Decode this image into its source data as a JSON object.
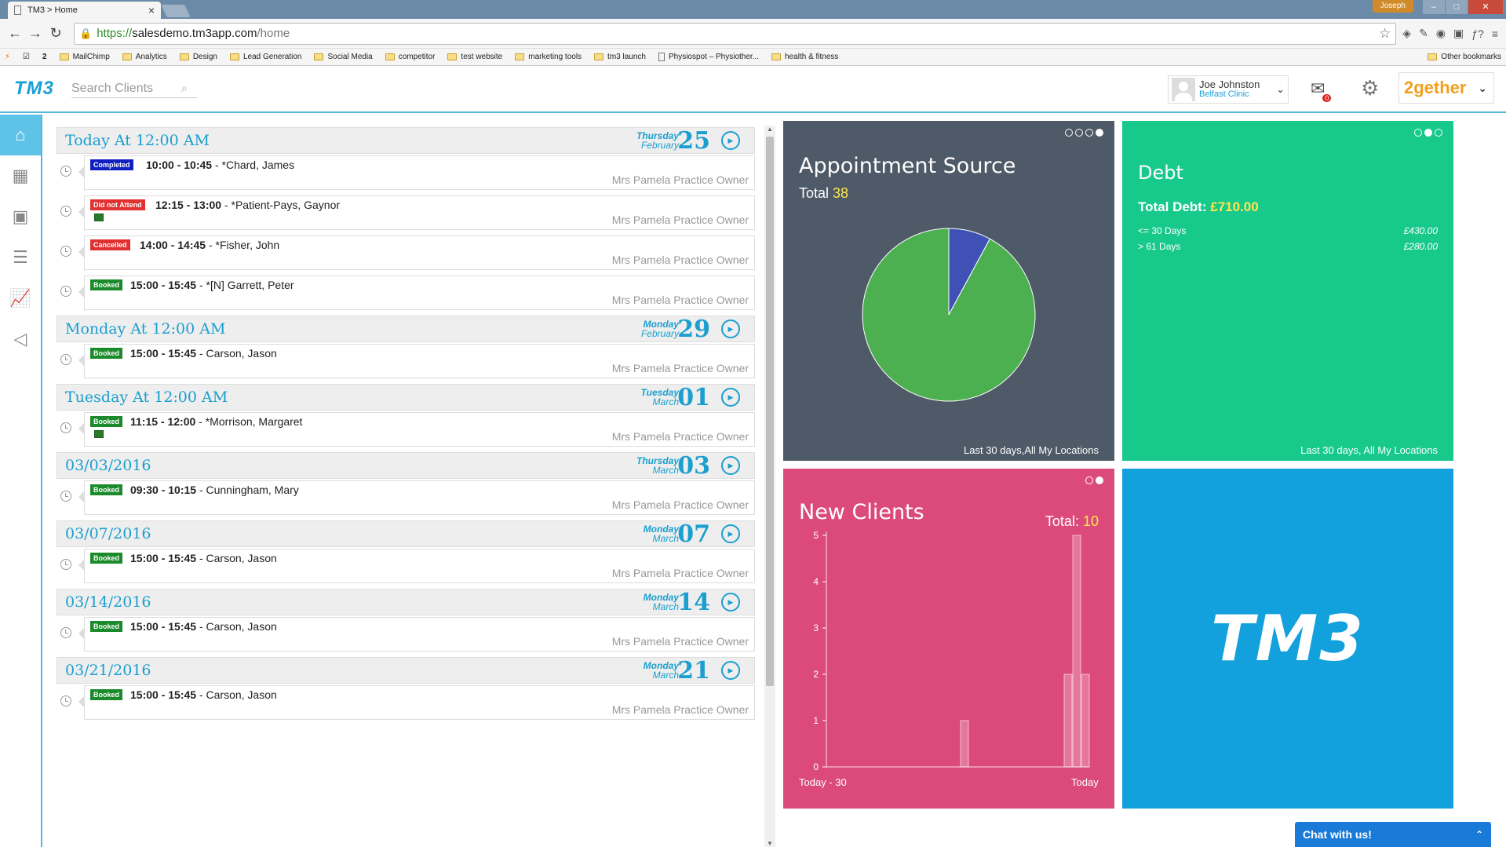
{
  "browser": {
    "tab_title": "TM3 > Home",
    "window_user": "Joseph",
    "url_scheme": "https://",
    "url_host": "salesdemo.tm3app.com",
    "url_path": "/home",
    "bookmarks": [
      "MailChimp",
      "Analytics",
      "Design",
      "Lead Generation",
      "Social Media",
      "competitor",
      "test website",
      "marketing tools",
      "tm3 launch",
      "Physiospot – Physiother...",
      "health & fitness"
    ],
    "other_bookmarks": "Other bookmarks"
  },
  "header": {
    "logo": "TM3",
    "search_placeholder": "Search Clients",
    "user_name": "Joe Johnston",
    "user_clinic": "Belfast Clinic",
    "inbox_count": "0",
    "brand": "2gether"
  },
  "agenda": [
    {
      "title": "Today At 12:00 AM",
      "weekday": "Thursday",
      "month": "February",
      "day": "25",
      "appointments": [
        {
          "status": "Completed",
          "status_class": "st-completed",
          "time": "10:00 - 10:45",
          "client": " - *Chard, James",
          "practitioner": "Mrs Pamela Practice Owner",
          "cash": false
        },
        {
          "status": "Did not Attend",
          "status_class": "st-dna",
          "time": "12:15 - 13:00",
          "client": " - *Patient-Pays, Gaynor",
          "practitioner": "Mrs Pamela Practice Owner",
          "cash": true
        },
        {
          "status": "Cancelled",
          "status_class": "st-cancelled",
          "time": "14:00 - 14:45",
          "client": " - *Fisher, John",
          "practitioner": "Mrs Pamela Practice Owner",
          "cash": false
        },
        {
          "status": "Booked",
          "status_class": "st-booked",
          "time": "15:00 - 15:45",
          "client": " - *[N] Garrett, Peter",
          "practitioner": "Mrs Pamela Practice Owner",
          "cash": false
        }
      ]
    },
    {
      "title": "Monday At 12:00 AM",
      "weekday": "Monday",
      "month": "February",
      "day": "29",
      "appointments": [
        {
          "status": "Booked",
          "status_class": "st-booked",
          "time": "15:00 - 15:45",
          "client": " - Carson, Jason",
          "practitioner": "Mrs Pamela Practice Owner",
          "cash": false
        }
      ]
    },
    {
      "title": "Tuesday At 12:00 AM",
      "weekday": "Tuesday",
      "month": "March",
      "day": "01",
      "appointments": [
        {
          "status": "Booked",
          "status_class": "st-booked",
          "time": "11:15 - 12:00",
          "client": " - *Morrison, Margaret",
          "practitioner": "Mrs Pamela Practice Owner",
          "cash": true
        }
      ]
    },
    {
      "title": "03/03/2016",
      "weekday": "Thursday",
      "month": "March",
      "day": "03",
      "appointments": [
        {
          "status": "Booked",
          "status_class": "st-booked",
          "time": "09:30 - 10:15",
          "client": " - Cunningham, Mary",
          "practitioner": "Mrs Pamela Practice Owner",
          "cash": false
        }
      ]
    },
    {
      "title": "03/07/2016",
      "weekday": "Monday",
      "month": "March",
      "day": "07",
      "appointments": [
        {
          "status": "Booked",
          "status_class": "st-booked",
          "time": "15:00 - 15:45",
          "client": " - Carson, Jason",
          "practitioner": "Mrs Pamela Practice Owner",
          "cash": false
        }
      ]
    },
    {
      "title": "03/14/2016",
      "weekday": "Monday",
      "month": "March",
      "day": "14",
      "appointments": [
        {
          "status": "Booked",
          "status_class": "st-booked",
          "time": "15:00 - 15:45",
          "client": " - Carson, Jason",
          "practitioner": "Mrs Pamela Practice Owner",
          "cash": false
        }
      ]
    },
    {
      "title": "03/21/2016",
      "weekday": "Monday",
      "month": "March",
      "day": "21",
      "appointments": [
        {
          "status": "Booked",
          "status_class": "st-booked",
          "time": "15:00 - 15:45",
          "client": " - Carson, Jason",
          "practitioner": "Mrs Pamela Practice Owner",
          "cash": false
        }
      ]
    }
  ],
  "tiles": {
    "appointment_source": {
      "title": "Appointment Source",
      "total_label": "Total",
      "total": "38",
      "footer": "Last 30 days,All My Locations"
    },
    "debt": {
      "title": "Debt",
      "total_label": "Total Debt:",
      "total": "£710.00",
      "rows": [
        {
          "label": "<= 30 Days",
          "value": "£430.00"
        },
        {
          "label": "> 61 Days",
          "value": "£280.00"
        }
      ],
      "footer": "Last 30 days, All My Locations"
    },
    "new_clients": {
      "title": "New Clients",
      "total_label": "Total:",
      "total": "10",
      "x_start": "Today - 30",
      "x_end": "Today"
    },
    "logo": "TM3"
  },
  "chart_data": [
    {
      "type": "pie",
      "title": "Appointment Source",
      "total": 38,
      "slices": [
        {
          "value": 35,
          "color": "#4caf50"
        },
        {
          "value": 3,
          "color": "#3f51b5"
        }
      ]
    },
    {
      "type": "bar",
      "title": "New Clients",
      "xlabel_start": "Today - 30",
      "xlabel_end": "Today",
      "ylim": [
        0,
        5
      ],
      "yticks": [
        0,
        1,
        2,
        3,
        4,
        5
      ],
      "days": 31,
      "bars": [
        {
          "day": 16,
          "value": 1
        },
        {
          "day": 28,
          "value": 2
        },
        {
          "day": 29,
          "value": 5
        },
        {
          "day": 30,
          "value": 2
        }
      ]
    }
  ],
  "chat": {
    "label": "Chat with us!"
  },
  "colors": {
    "accent": "#1a9fcf",
    "appt_tile": "#4e5a67",
    "debt_tile": "#18c98c",
    "clients_tile": "#dc4a7c",
    "logo_tile": "#13a1dd"
  }
}
